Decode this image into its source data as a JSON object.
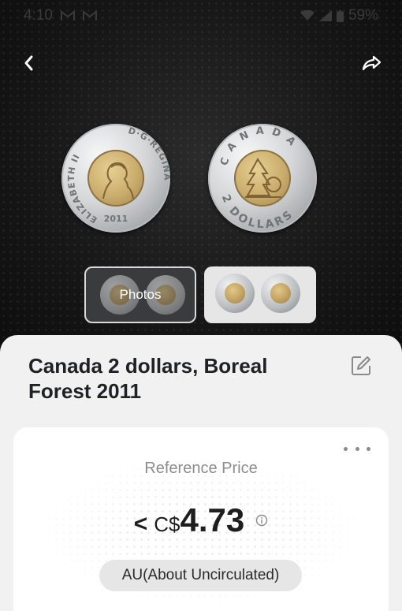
{
  "status_bar": {
    "time": "4:10",
    "app_icons": [
      "gmail-icon",
      "gmail-icon"
    ],
    "battery": "59%"
  },
  "nav": {
    "back_icon": "chevron-left-icon",
    "share_icon": "share-arrow-icon"
  },
  "coin_images": {
    "obverse": {
      "left_text": "ELIZABETH II",
      "right_text": "D·G·REGINA",
      "year": "2011"
    },
    "reverse": {
      "top_text": "CANADA",
      "bottom_text": "2 DOLLARS"
    }
  },
  "thumbnails": {
    "photos_label": "Photos"
  },
  "coin": {
    "title": "Canada 2 dollars, Boreal Forest 2011",
    "edit_icon": "edit-icon"
  },
  "price_card": {
    "more_icon": "more-dots-icon",
    "reference_label": "Reference Price",
    "prefix": "<",
    "currency": "C$",
    "amount": "4.73",
    "info_icon": "info-icon",
    "grade": "AU(About Uncirculated)"
  },
  "colors": {
    "sheet_bg": "#f1f1f1",
    "hero_bg": "#161616",
    "title_text": "#202124"
  }
}
